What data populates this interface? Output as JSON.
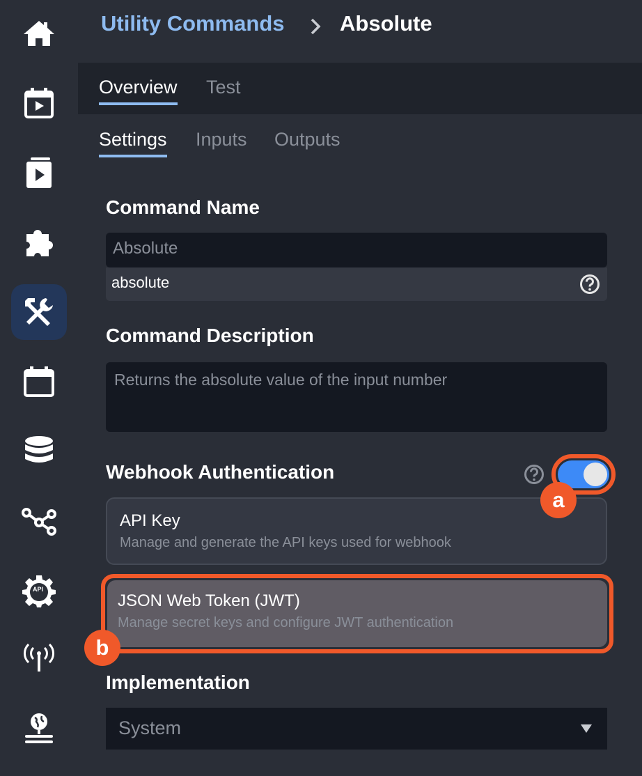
{
  "sidebar": {
    "items": [
      {
        "icon": "home-icon"
      },
      {
        "icon": "scheduled-video-icon"
      },
      {
        "icon": "playlist-icon"
      },
      {
        "icon": "puzzle-icon"
      },
      {
        "icon": "tools-icon",
        "active": true
      },
      {
        "icon": "calendar-icon"
      },
      {
        "icon": "database-icon"
      },
      {
        "icon": "share-nodes-icon"
      },
      {
        "icon": "api-settings-icon",
        "badge": "API"
      },
      {
        "icon": "broadcast-icon"
      },
      {
        "icon": "globe-server-icon"
      }
    ]
  },
  "header": {
    "breadcrumb_parent": "Utility Commands",
    "breadcrumb_current": "Absolute"
  },
  "tabs": {
    "overview": "Overview",
    "test": "Test"
  },
  "subtabs": {
    "settings": "Settings",
    "inputs": "Inputs",
    "outputs": "Outputs"
  },
  "command_name": {
    "title": "Command Name",
    "value": "Absolute",
    "slug": "absolute"
  },
  "command_description": {
    "title": "Command Description",
    "value": "Returns the absolute value of the input number"
  },
  "webhook_auth": {
    "title": "Webhook Authentication",
    "enabled": true,
    "options": [
      {
        "title": "API Key",
        "subtitle": "Manage and generate the API keys used for webhook"
      },
      {
        "title": "JSON Web Token (JWT)",
        "subtitle": "Manage secret keys and configure JWT authentication"
      }
    ]
  },
  "implementation": {
    "title": "Implementation",
    "selected": "System"
  },
  "callouts": {
    "a": "a",
    "b": "b"
  },
  "colors": {
    "accent": "#8ebbf0",
    "highlight": "#f0592a",
    "toggle_on": "#3d8af7",
    "active_nav": "#23375a"
  }
}
